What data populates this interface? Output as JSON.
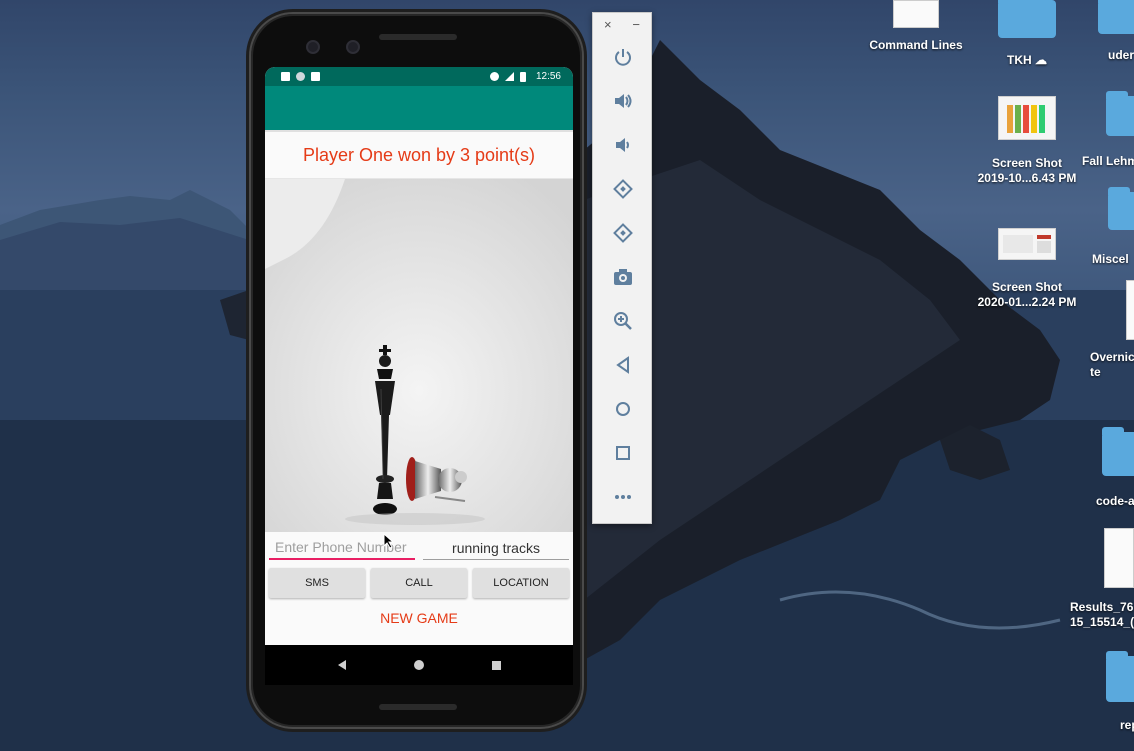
{
  "phone": {
    "status_time": "12:56",
    "result_text": "Player One won by 3 point(s)",
    "phone_placeholder": "Enter Phone Number",
    "tracks_label": "running tracks",
    "buttons": {
      "sms": "SMS",
      "call": "CALL",
      "location": "LOCATION",
      "new_game": "NEW GAME"
    }
  },
  "emulator_toolbar": {
    "close": "×",
    "minimize": "−",
    "tools": [
      "power-icon",
      "volume-up-icon",
      "volume-down-icon",
      "rotate-left-icon",
      "rotate-right-icon",
      "camera-icon",
      "zoom-icon",
      "back-icon",
      "home-icon",
      "overview-icon",
      "more-icon"
    ]
  },
  "desktop": {
    "icons": [
      {
        "label": "Command Lines"
      },
      {
        "label": "TKH ☁"
      },
      {
        "label": "uder"
      },
      {
        "label": "Screen Shot\n2019-10...6.43 PM"
      },
      {
        "label": "Fall Lehm"
      },
      {
        "label": "Miscel"
      },
      {
        "label": "Screen Shot\n2020-01...2.24 PM"
      },
      {
        "label": "Overnic\nte"
      },
      {
        "label": "code-a"
      },
      {
        "label": "Results_76\n15_15514_("
      },
      {
        "label": "rep"
      }
    ]
  },
  "colors": {
    "accent_red": "#e53b17",
    "status_teal": "#00695c",
    "appbar_teal": "#00897b",
    "underline_pink": "#e91e63"
  }
}
